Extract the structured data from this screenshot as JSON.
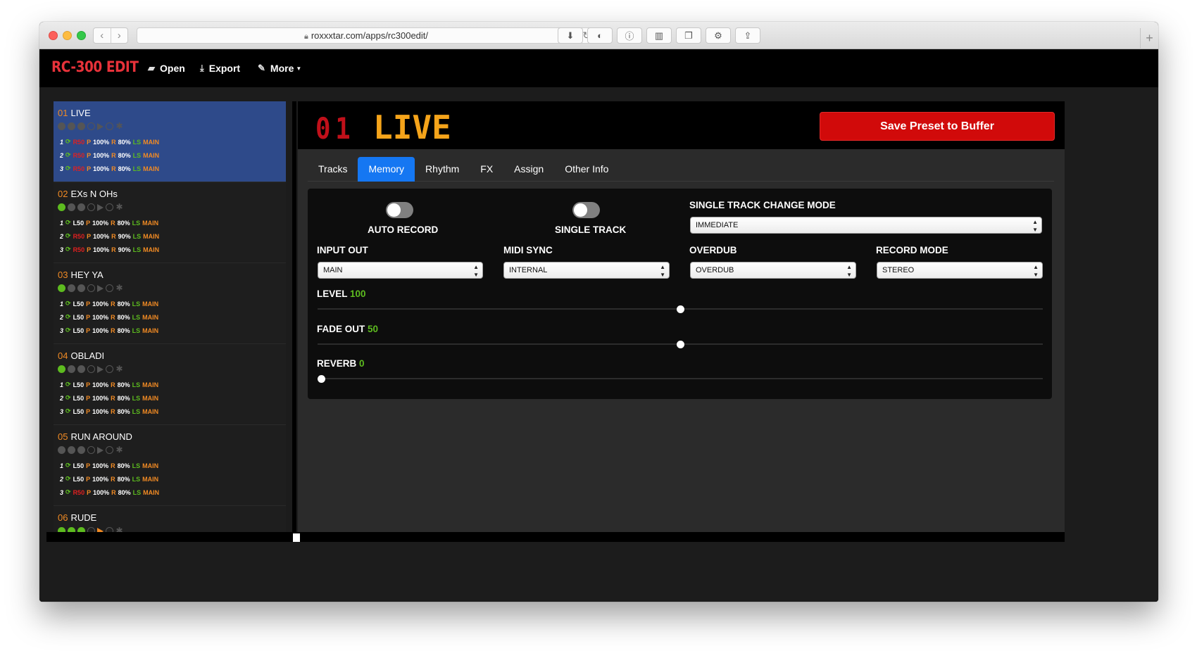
{
  "browser": {
    "url": "roxxxtar.com/apps/rc300edit/"
  },
  "navbar": {
    "brand": "RC-300 EDIT",
    "open_label": "Open",
    "export_label": "Export",
    "more_label": "More"
  },
  "presets": [
    {
      "num": "01",
      "name": "LIVE",
      "active": true,
      "tracks": [
        {
          "n": "1",
          "loop": "R50",
          "loop_red": true,
          "p": "100%",
          "r": "80%",
          "ls": "LS",
          "out": "MAIN"
        },
        {
          "n": "2",
          "loop": "R50",
          "loop_red": true,
          "p": "100%",
          "r": "80%",
          "ls": "LS",
          "out": "MAIN"
        },
        {
          "n": "3",
          "loop": "R50",
          "loop_red": true,
          "p": "100%",
          "r": "80%",
          "ls": "LS",
          "out": "MAIN"
        }
      ]
    },
    {
      "num": "02",
      "name": "EXs N OHs",
      "active": false,
      "tracks": [
        {
          "n": "1",
          "loop": "L50",
          "loop_red": false,
          "p": "100%",
          "r": "80%",
          "ls": "LS",
          "out": "MAIN"
        },
        {
          "n": "2",
          "loop": "R50",
          "loop_red": true,
          "p": "100%",
          "r": "90%",
          "ls": "LS",
          "out": "MAIN"
        },
        {
          "n": "3",
          "loop": "R50",
          "loop_red": true,
          "p": "100%",
          "r": "90%",
          "ls": "LS",
          "out": "MAIN"
        }
      ]
    },
    {
      "num": "03",
      "name": "HEY YA",
      "active": false,
      "tracks": [
        {
          "n": "1",
          "loop": "L50",
          "loop_red": false,
          "p": "100%",
          "r": "80%",
          "ls": "LS",
          "out": "MAIN"
        },
        {
          "n": "2",
          "loop": "L50",
          "loop_red": false,
          "p": "100%",
          "r": "80%",
          "ls": "LS",
          "out": "MAIN"
        },
        {
          "n": "3",
          "loop": "L50",
          "loop_red": false,
          "p": "100%",
          "r": "80%",
          "ls": "LS",
          "out": "MAIN"
        }
      ]
    },
    {
      "num": "04",
      "name": "OBLADI",
      "active": false,
      "tracks": [
        {
          "n": "1",
          "loop": "L50",
          "loop_red": false,
          "p": "100%",
          "r": "80%",
          "ls": "LS",
          "out": "MAIN"
        },
        {
          "n": "2",
          "loop": "L50",
          "loop_red": false,
          "p": "100%",
          "r": "80%",
          "ls": "LS",
          "out": "MAIN"
        },
        {
          "n": "3",
          "loop": "L50",
          "loop_red": false,
          "p": "100%",
          "r": "80%",
          "ls": "LS",
          "out": "MAIN"
        }
      ]
    },
    {
      "num": "05",
      "name": "RUN AROUND",
      "active": false,
      "tracks": [
        {
          "n": "1",
          "loop": "L50",
          "loop_red": false,
          "p": "100%",
          "r": "80%",
          "ls": "LS",
          "out": "MAIN"
        },
        {
          "n": "2",
          "loop": "L50",
          "loop_red": false,
          "p": "100%",
          "r": "80%",
          "ls": "LS",
          "out": "MAIN"
        },
        {
          "n": "3",
          "loop": "R50",
          "loop_red": true,
          "p": "100%",
          "r": "80%",
          "ls": "LS",
          "out": "MAIN"
        }
      ]
    },
    {
      "num": "06",
      "name": "RUDE",
      "active": false,
      "tracks": []
    }
  ],
  "preset_track_labels": {
    "p": "P",
    "r": "R"
  },
  "header": {
    "preset_number": "01",
    "preset_name": "LIVE",
    "save_label": "Save Preset to Buffer"
  },
  "tabs": [
    "Tracks",
    "Memory",
    "Rhythm",
    "FX",
    "Assign",
    "Other Info"
  ],
  "active_tab": "Memory",
  "memory": {
    "auto_record_label": "AUTO RECORD",
    "auto_record_on": false,
    "single_track_label": "SINGLE TRACK",
    "single_track_on": false,
    "single_track_change_mode_label": "SINGLE TRACK CHANGE MODE",
    "single_track_change_mode_value": "IMMEDIATE",
    "input_out_label": "INPUT OUT",
    "input_out_value": "MAIN",
    "midi_sync_label": "MIDI SYNC",
    "midi_sync_value": "INTERNAL",
    "overdub_label": "OVERDUB",
    "overdub_value": "OVERDUB",
    "record_mode_label": "RECORD MODE",
    "record_mode_value": "STEREO",
    "level_label": "LEVEL",
    "level_value": "100",
    "level_fraction": 0.5,
    "fade_out_label": "FADE OUT",
    "fade_out_value": "50",
    "fade_out_fraction": 0.5,
    "reverb_label": "REVERB",
    "reverb_value": "0",
    "reverb_fraction": 0.0
  },
  "colors": {
    "accent_blue": "#1577f2",
    "save_red": "#d10a0a",
    "preset_orange": "#f5a41a",
    "value_green": "#5dbb1f"
  }
}
